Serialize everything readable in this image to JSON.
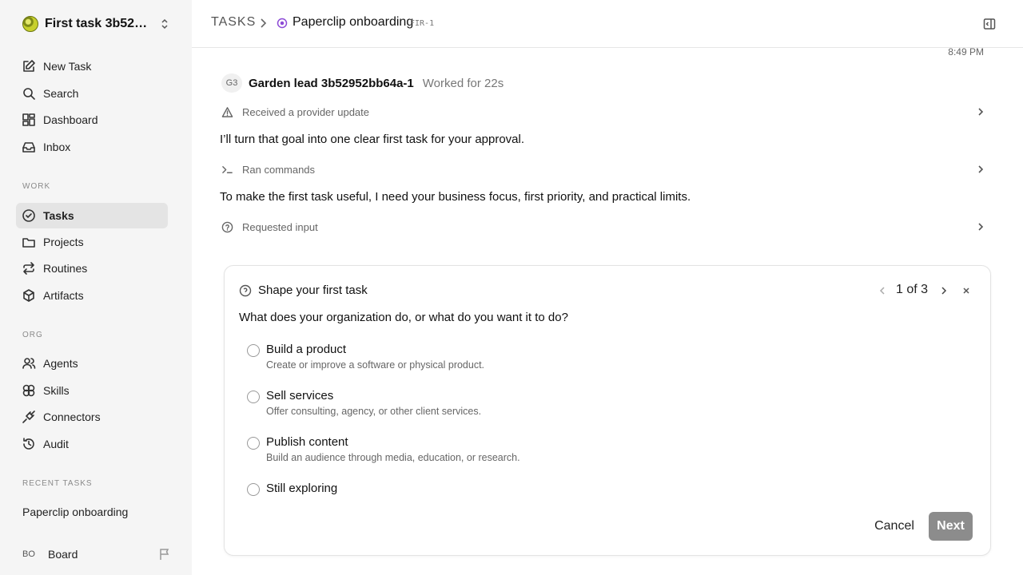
{
  "workspace": {
    "name": "First task 3b5295..."
  },
  "sidebar": {
    "top_items": [
      {
        "label": "New Task",
        "icon": "edit-icon"
      },
      {
        "label": "Search",
        "icon": "search-icon"
      },
      {
        "label": "Dashboard",
        "icon": "dashboard-icon"
      },
      {
        "label": "Inbox",
        "icon": "inbox-icon"
      }
    ],
    "work_label": "WORK",
    "work_items": [
      {
        "label": "Tasks",
        "icon": "check-circle-icon",
        "active": true
      },
      {
        "label": "Projects",
        "icon": "folder-icon"
      },
      {
        "label": "Routines",
        "icon": "repeat-icon"
      },
      {
        "label": "Artifacts",
        "icon": "box-icon"
      }
    ],
    "org_label": "ORG",
    "org_items": [
      {
        "label": "Agents",
        "icon": "users-icon"
      },
      {
        "label": "Skills",
        "icon": "skills-icon"
      },
      {
        "label": "Connectors",
        "icon": "plug-icon"
      },
      {
        "label": "Audit",
        "icon": "history-icon"
      }
    ],
    "recent_label": "RECENT TASKS",
    "recent_items": [
      "Paperclip onboarding"
    ],
    "board": {
      "initials": "BO",
      "name": "Board"
    }
  },
  "header": {
    "root": "TASKS",
    "title": "Paperclip onboarding",
    "task_id": "FIR-1"
  },
  "feed": {
    "time": "8:49 PM",
    "agent": {
      "initials": "G3",
      "name": "Garden lead 3b52952bb64a-1",
      "meta": "Worked for 22s"
    },
    "event_provider": "Received a provider update",
    "message_1": "I’ll turn that goal into one clear first task for your approval.",
    "event_commands": "Ran commands",
    "message_2": "To make the first task useful, I need your business focus, first priority, and practical limits.",
    "event_input": "Requested input"
  },
  "card": {
    "title": "Shape your first task",
    "pager": "1 of 3",
    "question": "What does your organization do, or what do you want it to do?",
    "options": [
      {
        "label": "Build a product",
        "desc": "Create or improve a software or physical product."
      },
      {
        "label": "Sell services",
        "desc": "Offer consulting, agency, or other client services."
      },
      {
        "label": "Publish content",
        "desc": "Build an audience through media, education, or research."
      },
      {
        "label": "Still exploring",
        "desc": ""
      }
    ],
    "cancel_label": "Cancel",
    "next_label": "Next"
  },
  "colors": {
    "accent_purple": "#8d4bd6",
    "next_button": "#8c8c8c",
    "sidebar_bg": "#f5f5f5"
  }
}
